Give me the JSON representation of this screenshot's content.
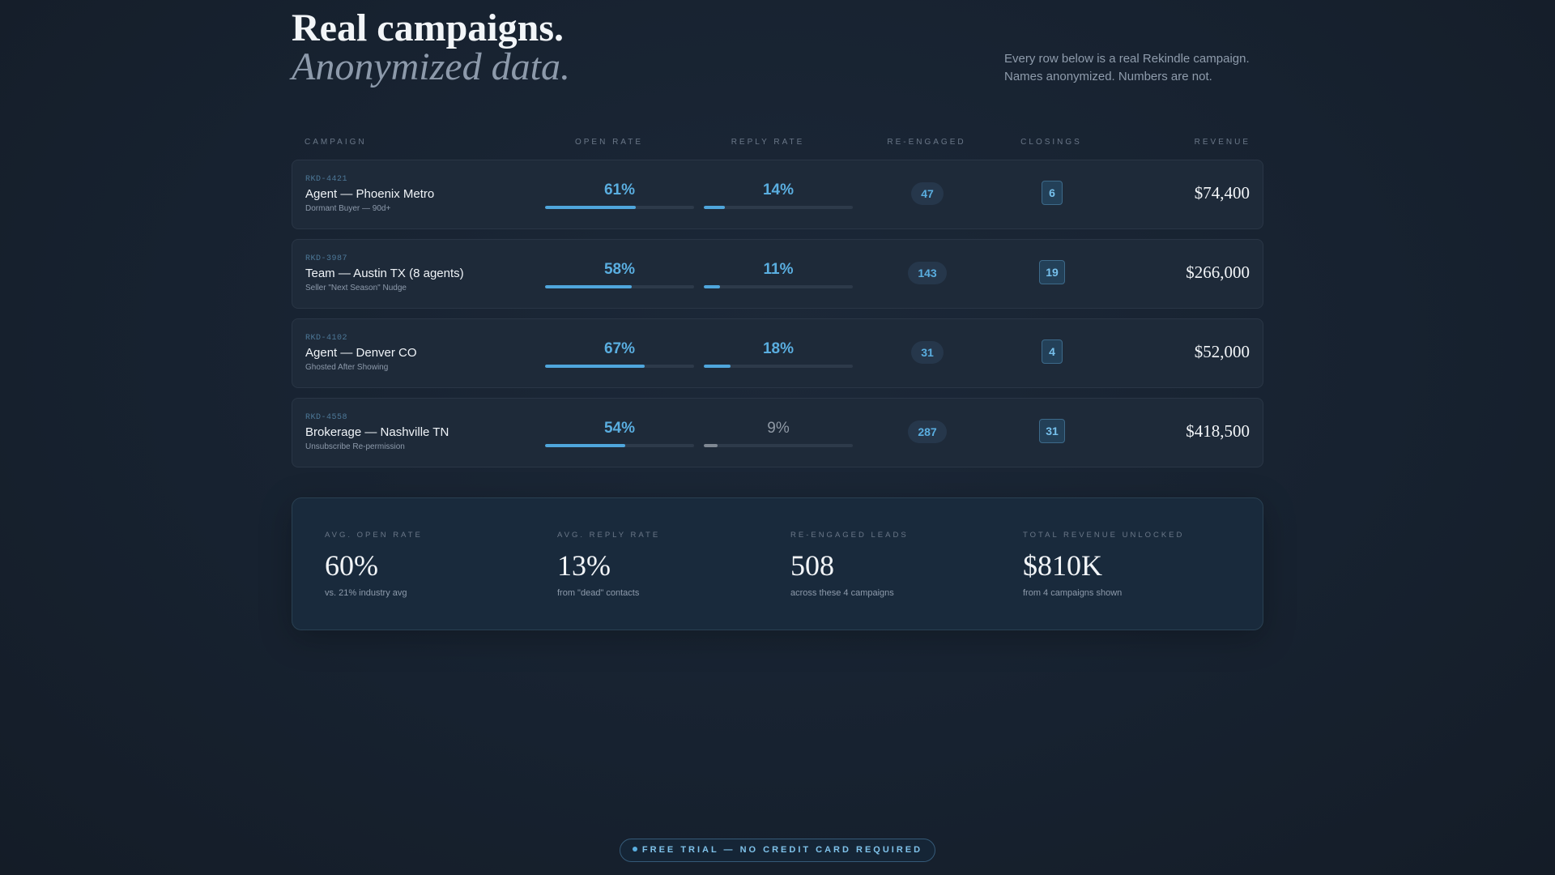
{
  "hero": {
    "title_line1": "Real campaigns.",
    "title_line2": "Anonymized data.",
    "description_line1": "Every row below is a real Rekindle campaign.",
    "description_line2": "Names anonymized. Numbers are not."
  },
  "table": {
    "headers": {
      "campaign": "CAMPAIGN",
      "open_rate": "OPEN RATE",
      "reply_rate": "REPLY RATE",
      "re_engaged": "RE-ENGAGED",
      "closings": "CLOSINGS",
      "revenue": "REVENUE"
    },
    "rows": [
      {
        "id": "RKD-4421",
        "name": "Agent — Phoenix Metro",
        "subtitle": "Dormant Buyer — 90d+",
        "open_rate": "61%",
        "open_value": 61,
        "reply_rate": "14%",
        "reply_value": 14,
        "reply_muted": false,
        "re_engaged": "47",
        "closings": "6",
        "revenue": "$74,400"
      },
      {
        "id": "RKD-3987",
        "name": "Team — Austin TX (8 agents)",
        "subtitle": "Seller \"Next Season\" Nudge",
        "open_rate": "58%",
        "open_value": 58,
        "reply_rate": "11%",
        "reply_value": 11,
        "reply_muted": false,
        "re_engaged": "143",
        "closings": "19",
        "revenue": "$266,000"
      },
      {
        "id": "RKD-4102",
        "name": "Agent — Denver CO",
        "subtitle": "Ghosted After Showing",
        "open_rate": "67%",
        "open_value": 67,
        "reply_rate": "18%",
        "reply_value": 18,
        "reply_muted": false,
        "re_engaged": "31",
        "closings": "4",
        "revenue": "$52,000"
      },
      {
        "id": "RKD-4558",
        "name": "Brokerage — Nashville TN",
        "subtitle": "Unsubscribe Re-permission",
        "open_rate": "54%",
        "open_value": 54,
        "reply_rate": "9%",
        "reply_value": 9,
        "reply_muted": true,
        "re_engaged": "287",
        "closings": "31",
        "revenue": "$418,500"
      }
    ]
  },
  "summary": {
    "stats": [
      {
        "label": "AVG. OPEN RATE",
        "value": "60%",
        "note": "vs. 21% industry avg"
      },
      {
        "label": "AVG. REPLY RATE",
        "value": "13%",
        "note": "from \"dead\" contacts"
      },
      {
        "label": "RE-ENGAGED LEADS",
        "value": "508",
        "note": "across these 4 campaigns"
      },
      {
        "label": "TOTAL REVENUE UNLOCKED",
        "value": "$810K",
        "note": "from 4 campaigns shown"
      }
    ]
  },
  "cta": {
    "label": "FREE TRIAL — NO CREDIT CARD REQUIRED"
  },
  "colors": {
    "accent": "#5aaee0",
    "muted": "#8f99a5",
    "background": "#172230"
  }
}
